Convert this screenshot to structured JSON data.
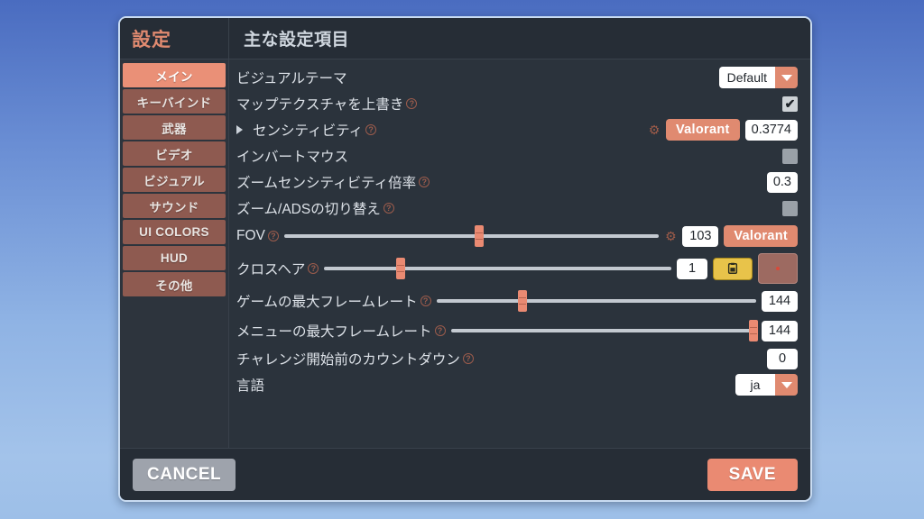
{
  "header": {
    "settings_title": "設定",
    "main_title": "主な設定項目"
  },
  "sidebar": {
    "items": [
      {
        "label": "メイン",
        "active": true
      },
      {
        "label": "キーバインド",
        "active": false
      },
      {
        "label": "武器",
        "active": false
      },
      {
        "label": "ビデオ",
        "active": false
      },
      {
        "label": "ビジュアル",
        "active": false
      },
      {
        "label": "サウンド",
        "active": false
      },
      {
        "label": "UI COLORS",
        "active": false
      },
      {
        "label": "HUD",
        "active": false
      },
      {
        "label": "その他",
        "active": false
      }
    ]
  },
  "settings": {
    "visual_theme": {
      "label": "ビジュアルテーマ",
      "value": "Default"
    },
    "map_texture_override": {
      "label": "マップテクスチャを上書き",
      "help": "?",
      "checked": "✔"
    },
    "sensitivity": {
      "label": "センシティビティ",
      "help": "?",
      "preset": "Valorant",
      "value": "0.3774"
    },
    "invert_mouse": {
      "label": "インバートマウス",
      "checked": ""
    },
    "zoom_sensitivity": {
      "label": "ズームセンシティビティ倍率",
      "help": "?",
      "value": "0.3"
    },
    "toggle_zoom_ads": {
      "label": "ズーム/ADSの切り替え",
      "help": "?",
      "checked": ""
    },
    "fov": {
      "label": "FOV",
      "help": "?",
      "value": "103",
      "preset": "Valorant",
      "slider_percent": 52
    },
    "crosshair": {
      "label": "クロスヘア",
      "help": "?",
      "value": "1",
      "slider_percent": 22,
      "copy_icon": "clipboard-icon"
    },
    "game_max_framerate": {
      "label": "ゲームの最大フレームレート",
      "help": "?",
      "value": "144",
      "slider_percent": 27
    },
    "menu_max_framerate": {
      "label": "メニューの最大フレームレート",
      "help": "?",
      "value": "144",
      "slider_percent": 99
    },
    "challenge_countdown": {
      "label": "チャレンジ開始前のカウントダウン",
      "help": "?",
      "value": "0"
    },
    "language": {
      "label": "言語",
      "value": "ja"
    }
  },
  "footer": {
    "cancel_label": "CANCEL",
    "save_label": "SAVE"
  },
  "colors": {
    "accent": "#ea8a72",
    "sidebar_item": "#8e5a50",
    "panel": "#2b333c",
    "copy_button": "#e8c34a"
  }
}
